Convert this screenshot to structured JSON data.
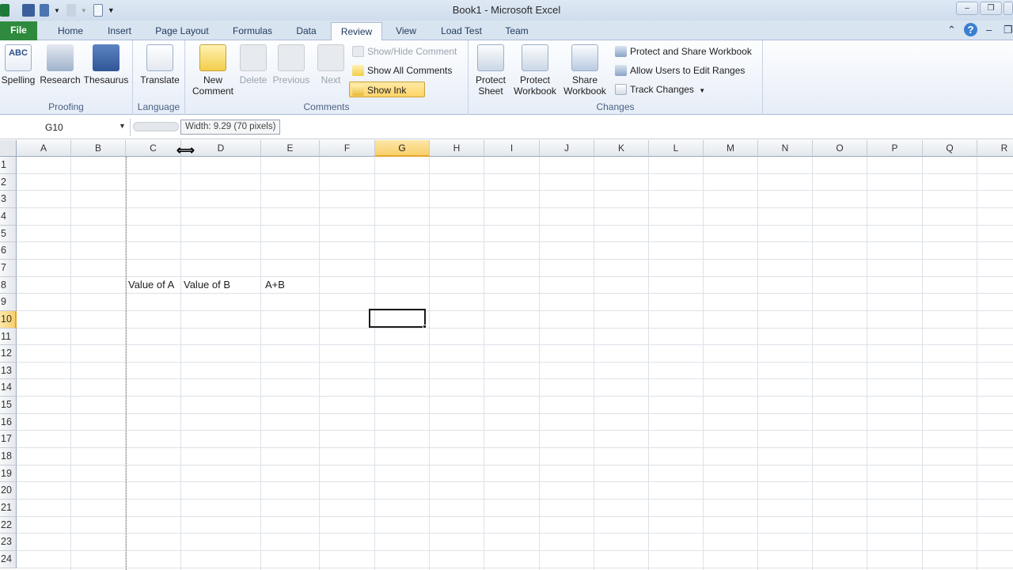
{
  "window": {
    "title": "Book1  -  Microsoft Excel"
  },
  "tabs": [
    "File",
    "Home",
    "Insert",
    "Page Layout",
    "Formulas",
    "Data",
    "Review",
    "View",
    "Load Test",
    "Team"
  ],
  "ribbon": {
    "proofing": {
      "label": "Proofing",
      "spelling": "Spelling",
      "research": "Research",
      "thesaurus": "Thesaurus"
    },
    "language": {
      "label": "Language",
      "translate": "Translate"
    },
    "comments": {
      "label": "Comments",
      "new_comment_1": "New",
      "new_comment_2": "Comment",
      "delete": "Delete",
      "previous": "Previous",
      "next": "Next",
      "show_hide": "Show/Hide Comment",
      "show_all": "Show All Comments",
      "show_ink": "Show Ink"
    },
    "changes": {
      "label": "Changes",
      "protect_sheet_1": "Protect",
      "protect_sheet_2": "Sheet",
      "protect_workbook_1": "Protect",
      "protect_workbook_2": "Workbook",
      "share_workbook_1": "Share",
      "share_workbook_2": "Workbook",
      "protect_share": "Protect and Share Workbook",
      "allow_users": "Allow Users to Edit Ranges",
      "track_changes": "Track Changes"
    }
  },
  "formula_bar": {
    "name_box": "G10",
    "tooltip": "Width: 9.29 (70 pixels)"
  },
  "sheet": {
    "columns": [
      "A",
      "B",
      "C",
      "D",
      "E",
      "F",
      "G",
      "H",
      "I",
      "J",
      "K",
      "L",
      "M",
      "N",
      "O",
      "P",
      "Q",
      "R"
    ],
    "rows": [
      "1",
      "2",
      "3",
      "4",
      "5",
      "6",
      "7",
      "8",
      "9",
      "10",
      "11",
      "12",
      "13",
      "14",
      "15",
      "16",
      "17",
      "18",
      "19",
      "20",
      "21",
      "22",
      "23",
      "24"
    ],
    "selected_col": "G",
    "selected_row": "10",
    "cells": {
      "C8": "Value of A",
      "D8": "Value of B",
      "E8": "A+B"
    }
  },
  "colors": {
    "file_tab": "#2e8b3d",
    "selection_header": "#f9cf6b"
  }
}
